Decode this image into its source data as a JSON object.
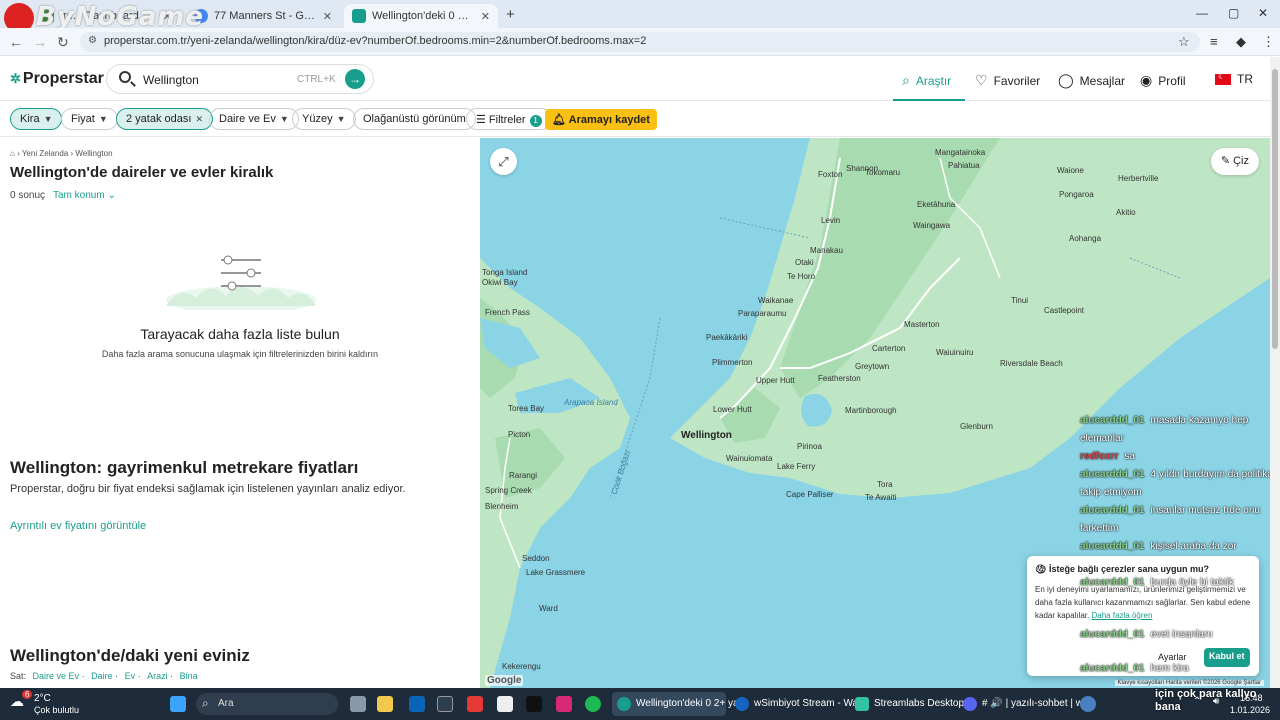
{
  "overlay": {
    "watermark": "ByNoGame"
  },
  "browser": {
    "tabs": [
      {
        "title": "tre... Dashboard",
        "favicon_color": "#2e7d32"
      },
      {
        "title": "77 Manners St - Google Haritalar",
        "favicon_color": "#4285f4"
      },
      {
        "title": "Wellington'deki 0 2+ yatak odası",
        "favicon_color": "#1a9e8c"
      }
    ],
    "new_tab": "+",
    "window_controls": {
      "minimize": "—",
      "maximize": "▢",
      "close": "✕"
    },
    "url": "properstar.com.tr/yeni-zelanda/wellington/kira/düz-ev?numberOf.bedrooms.min=2&numberOf.bedrooms.max=2"
  },
  "site": {
    "brand": "Properstar",
    "search": {
      "value": "Wellington",
      "shortcut": "CTRL+K"
    },
    "nav": {
      "explore": "Araştır",
      "favorites": "Favoriler",
      "messages": "Mesajlar",
      "profile": "Profil",
      "language": "TR"
    }
  },
  "filters": {
    "rent": "Kira",
    "price": "Fiyat",
    "bedrooms": "2 yatak odası",
    "type": "Daire ve Ev",
    "surface": "Yüzey",
    "extraordinary": "Olağanüstü görünüm",
    "more": "Filtreler",
    "more_count": "1",
    "save": "Aramayı kaydet"
  },
  "results": {
    "breadcrumb": [
      "Yeni Zelanda",
      "Wellington"
    ],
    "title": "Wellington'de daireler ve evler kiralık",
    "count": "0 sonuç",
    "location_mode": "Tam konum",
    "empty_title": "Tarayacak daha fazla liste bulun",
    "empty_sub": "Daha fazla arama sonucuna ulaşmak için filtrelerinizden birini kaldırın",
    "prices_title": "Wellington: gayrimenkul metrekare fiyatları",
    "prices_text": "Properstar, doğru bir fiyat endeksi sağlamak için listelenen yayınları analiz ediyor.",
    "prices_link": "Ayrıntılı ev fiyatını görüntüle",
    "new_home_title": "Wellington'de/daki yeni eviniz",
    "sale_label": "Sat:",
    "sale_links": [
      "Daire ve Ev",
      "Daire",
      "Ev",
      "Arazi",
      "Bina"
    ]
  },
  "map": {
    "draw": "Çiz",
    "google": "Google",
    "attribution": "Klavye kısayolları   Harita verileri ©2026 Google   Şartlar",
    "labels": [
      "Foxton",
      "Tokomaru",
      "Shannon",
      "Levin",
      "Manakau",
      "Te Horo",
      "Otaki",
      "Waikanae",
      "Paraparaumu",
      "Paekākāriki",
      "Plimmerton",
      "Upper Hutt",
      "Featherston",
      "Lower Hutt",
      "Martinborough",
      "Wellington",
      "Wainuiomata",
      "Pirinoa",
      "Lake Ferry",
      "Cape Palliser",
      "Tora",
      "Te Awaiti",
      "Greytown",
      "Carterton",
      "Masterton",
      "Waingawa",
      "Tinui",
      "Castlepoint",
      "Riversdale Beach",
      "Glenburn",
      "Mangatainoka",
      "Pahiatua",
      "Waione",
      "Herbertville",
      "Pongaroa",
      "Akitio",
      "Aohanga",
      "Eketāhuna",
      "Waiuinuiru",
      "Torea Bay",
      "Picton",
      "Rarangi",
      "Spring Creek",
      "Blenheim",
      "Seddon",
      "Lake Grassmere",
      "Ward",
      "Kekerengu",
      "Arapaoa Island",
      "Cook Boğazı",
      "French Pass",
      "Okiwi Bay",
      "Tonga Island"
    ]
  },
  "chat": [
    {
      "user": "alucarddd_01",
      "msg": "masada kazanıyo hep elemanlar",
      "color": "#8fd18f"
    },
    {
      "user": "redfoxrr",
      "msg": "sa",
      "color": "#e04a4a"
    },
    {
      "user": "alucarddd_01",
      "msg": "4 yıldır burdayım da politika takip etmiyom",
      "color": "#8fd18f"
    },
    {
      "user": "alucarddd_01",
      "msg": "insanlar mutsuz trde onu farkettim",
      "color": "#8fd18f"
    },
    {
      "user": "alucarddd_01",
      "msg": "kişisel araba da zor",
      "color": "#8fd18f"
    }
  ],
  "chat_bottom": [
    {
      "user": "alucarddd_01",
      "msg": "burda öyle bi taktik",
      "color": "#8fd18f"
    },
    {
      "user": "alucarddd_01",
      "msg": "evet insanlarıı",
      "color": "#8fd18f"
    },
    {
      "user": "alucarddd_01",
      "msg": "hem kira",
      "color": "#8fd18f"
    }
  ],
  "chat_tail": [
    "için çok para kallyo",
    "bana"
  ],
  "cookie": {
    "title": "İsteğe bağlı çerezler sana uygun mu?",
    "body": "En iyi deneyimi uyarlamamızı, ürünlerimizi geliştirmemizi ve daha fazla kullanıcı kazanmamızı sağlarlar. Sen kabul edene kadar kapalılar.",
    "learn_more": "Daha fazla öğren",
    "settings": "Ayarlar",
    "accept": "Kabul et"
  },
  "taskbar": {
    "weather_temp": "2°C",
    "weather_desc": "Çok bulutlu",
    "weather_badge": "6",
    "search": "Ara",
    "apps": [
      {
        "label": "Wellington'deki 0 2+ ya",
        "color": "#1a9e8c"
      },
      {
        "label": "wSimbiyot Stream - Wa",
        "color": "#1565c0"
      },
      {
        "label": "Streamlabs Desktop",
        "color": "#31c3a2"
      },
      {
        "label": "# 🔊 | yazılı-sohbet | wS",
        "color": "#5865f2"
      }
    ],
    "time": "16:48",
    "date": "1.01.2026"
  }
}
